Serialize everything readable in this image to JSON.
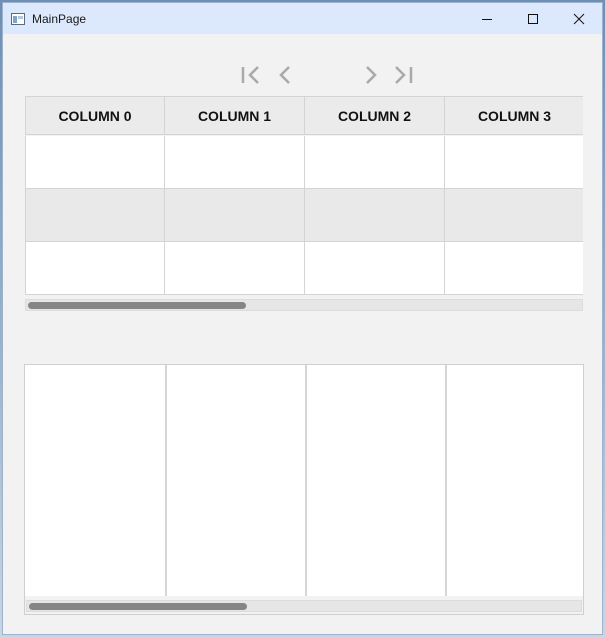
{
  "window": {
    "title": "MainPage",
    "icons": {
      "app": "app-window-icon",
      "minimize": "minimize-icon",
      "maximize": "maximize-icon",
      "close": "close-icon"
    }
  },
  "pager": {
    "icons": [
      "first-page-icon",
      "previous-page-icon",
      "next-page-icon",
      "last-page-icon"
    ]
  },
  "grid_top": {
    "columns": [
      "COLUMN 0",
      "COLUMN 1",
      "COLUMN 2",
      "COLUMN 3"
    ],
    "rows": [
      [
        "",
        "",
        "",
        ""
      ],
      [
        "",
        "",
        "",
        ""
      ],
      [
        "",
        "",
        "",
        ""
      ]
    ],
    "colors": {
      "header_bg": "#ebebeb",
      "alt_row_bg": "#e9e9e9",
      "border": "#d4d4d4"
    }
  },
  "grid_bottom": {
    "columns": [
      "",
      "",
      "",
      ""
    ]
  },
  "colors": {
    "titlebar": "#dce8fb",
    "window_bg": "#f2f2f2",
    "scroll_thumb": "#858585"
  }
}
